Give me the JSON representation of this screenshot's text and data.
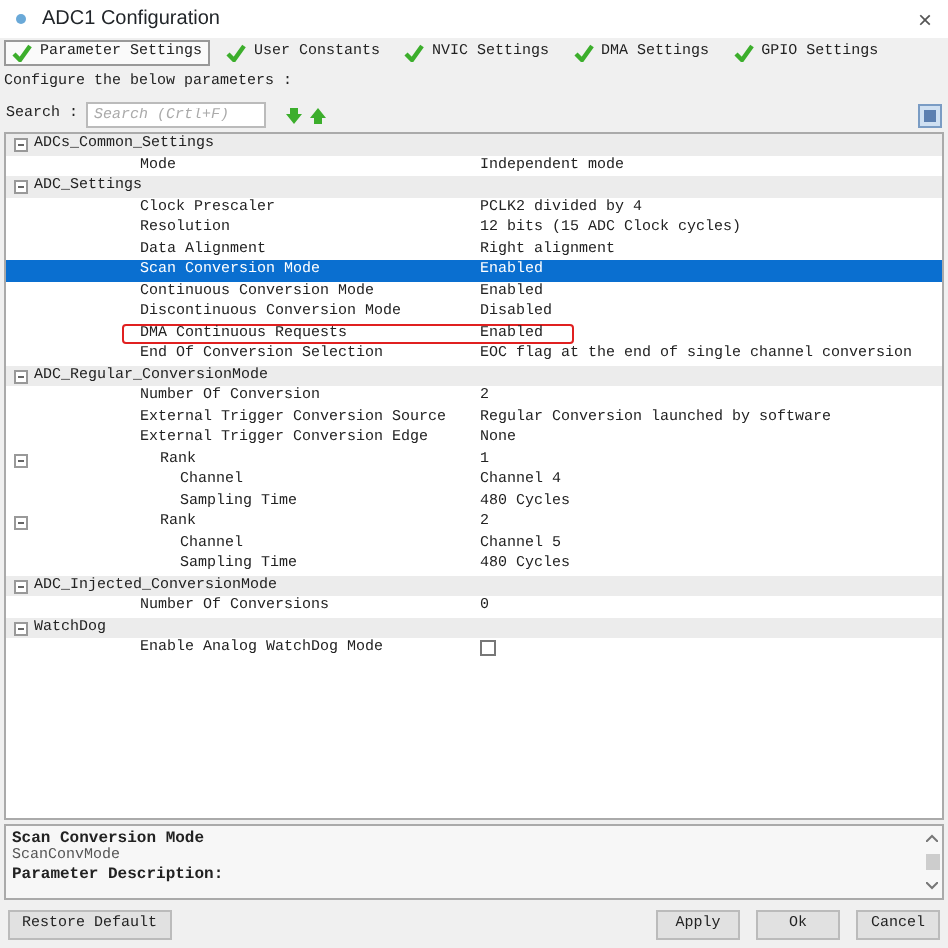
{
  "window": {
    "title": "ADC1 Configuration",
    "close": "×"
  },
  "tabs": [
    {
      "label": "Parameter Settings",
      "selected": true
    },
    {
      "label": "User Constants",
      "selected": false
    },
    {
      "label": "NVIC Settings",
      "selected": false
    },
    {
      "label": "DMA Settings",
      "selected": false
    },
    {
      "label": "GPIO Settings",
      "selected": false
    }
  ],
  "intro": "Configure the below parameters :",
  "search": {
    "label": "Search :",
    "placeholder": "Search (Crtl+F)"
  },
  "tree": [
    {
      "label": "ADCs_Common_Settings",
      "expanded": true,
      "children": [
        {
          "label": "Mode",
          "value": "Independent mode",
          "selected": false,
          "highlighted": false
        }
      ]
    },
    {
      "label": "ADC_Settings",
      "expanded": true,
      "children": [
        {
          "label": "Clock Prescaler",
          "value": "PCLK2 divided by 4",
          "selected": false,
          "highlighted": false
        },
        {
          "label": "Resolution",
          "value": "12 bits (15 ADC Clock cycles)",
          "selected": false,
          "highlighted": false
        },
        {
          "label": "Data Alignment",
          "value": "Right alignment",
          "selected": false,
          "highlighted": false
        },
        {
          "label": "Scan Conversion Mode",
          "value": "Enabled",
          "selected": true,
          "highlighted": false
        },
        {
          "label": "Continuous Conversion Mode",
          "value": "Enabled",
          "selected": false,
          "highlighted": false
        },
        {
          "label": "Discontinuous Conversion Mode",
          "value": "Disabled",
          "selected": false,
          "highlighted": false
        },
        {
          "label": "DMA Continuous Requests",
          "value": "Enabled",
          "selected": false,
          "highlighted": true
        },
        {
          "label": "End Of Conversion Selection",
          "value": "EOC flag at the end of single channel conversion",
          "selected": false,
          "highlighted": false
        }
      ]
    },
    {
      "label": "ADC_Regular_ConversionMode",
      "expanded": true,
      "children": [
        {
          "label": "Number Of Conversion",
          "value": "2",
          "selected": false,
          "highlighted": false
        },
        {
          "label": "External Trigger Conversion Source",
          "value": "Regular Conversion launched by software",
          "selected": false,
          "highlighted": false
        },
        {
          "label": "External Trigger Conversion Edge",
          "value": "None",
          "selected": false,
          "highlighted": false
        },
        {
          "label": "Rank",
          "value": "1",
          "selected": false,
          "highlighted": false,
          "expanded": true,
          "children": [
            {
              "label": "Channel",
              "value": "Channel 4",
              "selected": false,
              "highlighted": false
            },
            {
              "label": "Sampling Time",
              "value": "480 Cycles",
              "selected": false,
              "highlighted": false
            }
          ]
        },
        {
          "label": "Rank",
          "value": "2",
          "selected": false,
          "highlighted": false,
          "expanded": true,
          "children": [
            {
              "label": "Channel",
              "value": "Channel 5",
              "selected": false,
              "highlighted": false
            },
            {
              "label": "Sampling Time",
              "value": "480 Cycles",
              "selected": false,
              "highlighted": false
            }
          ]
        }
      ]
    },
    {
      "label": "ADC_Injected_ConversionMode",
      "expanded": true,
      "children": [
        {
          "label": "Number Of Conversions",
          "value": "0",
          "selected": false,
          "highlighted": false
        }
      ]
    },
    {
      "label": "WatchDog",
      "expanded": true,
      "children": [
        {
          "label": "Enable Analog WatchDog Mode",
          "kind": "checkbox",
          "checked": false,
          "selected": false,
          "highlighted": false
        }
      ]
    }
  ],
  "description": {
    "title": "Scan Conversion Mode",
    "param": "ScanConvMode",
    "heading": "Parameter Description:"
  },
  "buttons": [
    {
      "label": "Restore Default",
      "kind": "left"
    },
    {
      "label": "Apply",
      "kind": "right"
    },
    {
      "label": "Ok",
      "kind": "right"
    },
    {
      "label": "Cancel",
      "kind": "right"
    }
  ]
}
